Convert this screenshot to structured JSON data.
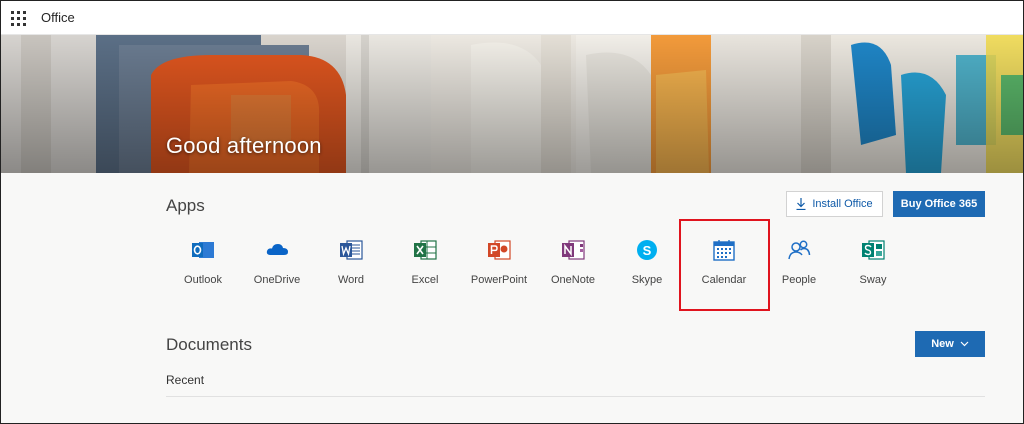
{
  "topbar": {
    "app_name": "Office",
    "menu_icon": "waffle-icon"
  },
  "hero": {
    "greeting": "Good afternoon"
  },
  "apps_section": {
    "title": "Apps",
    "install_label": "Install Office",
    "buy_label": "Buy Office 365",
    "items": [
      {
        "label": "Outlook",
        "icon": "outlook-icon",
        "color": "#0f6cbd"
      },
      {
        "label": "OneDrive",
        "icon": "onedrive-icon",
        "color": "#0a64c7"
      },
      {
        "label": "Word",
        "icon": "word-icon",
        "color": "#2b579a"
      },
      {
        "label": "Excel",
        "icon": "excel-icon",
        "color": "#217346"
      },
      {
        "label": "PowerPoint",
        "icon": "powerpoint-icon",
        "color": "#d24726"
      },
      {
        "label": "OneNote",
        "icon": "onenote-icon",
        "color": "#80397b"
      },
      {
        "label": "Skype",
        "icon": "skype-icon",
        "color": "#00aff0"
      },
      {
        "label": "Calendar",
        "icon": "calendar-icon",
        "color": "#1f6fc6"
      },
      {
        "label": "People",
        "icon": "people-icon",
        "color": "#1f6fc6"
      },
      {
        "label": "Sway",
        "icon": "sway-icon",
        "color": "#008272"
      }
    ]
  },
  "documents_section": {
    "title": "Documents",
    "new_label": "New",
    "recent_label": "Recent"
  },
  "colors": {
    "accent": "#1e6ab3",
    "highlight": "#e0141e"
  }
}
